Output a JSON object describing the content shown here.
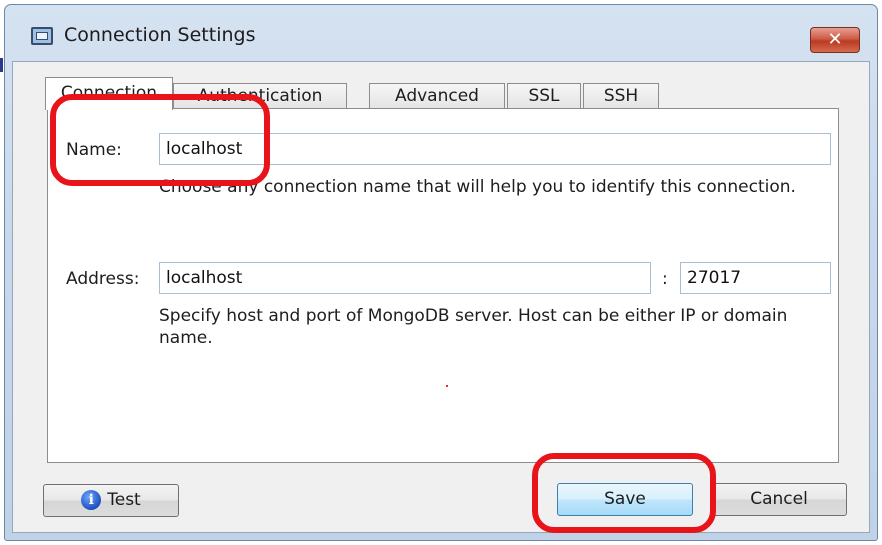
{
  "window": {
    "title": "Connection Settings",
    "close_symbol": "✕"
  },
  "tabs": [
    {
      "label": "Connection",
      "active": true
    },
    {
      "label": "Authentication",
      "active": false
    },
    {
      "label": "Advanced",
      "active": false
    },
    {
      "label": "SSL",
      "active": false
    },
    {
      "label": "SSH",
      "active": false
    }
  ],
  "connection": {
    "name_label": "Name:",
    "name_value": "localhost",
    "name_help": "Choose any connection name that will help you to identify this connection.",
    "address_label": "Address:",
    "host_value": "localhost",
    "port_separator": ":",
    "port_value": "27017",
    "address_help": "Specify host and port of MongoDB server. Host can be either IP or domain name."
  },
  "buttons": {
    "test_label": "Test",
    "test_icon": "info-icon",
    "save_label": "Save",
    "cancel_label": "Cancel"
  },
  "annotation_color": "#e8141a"
}
